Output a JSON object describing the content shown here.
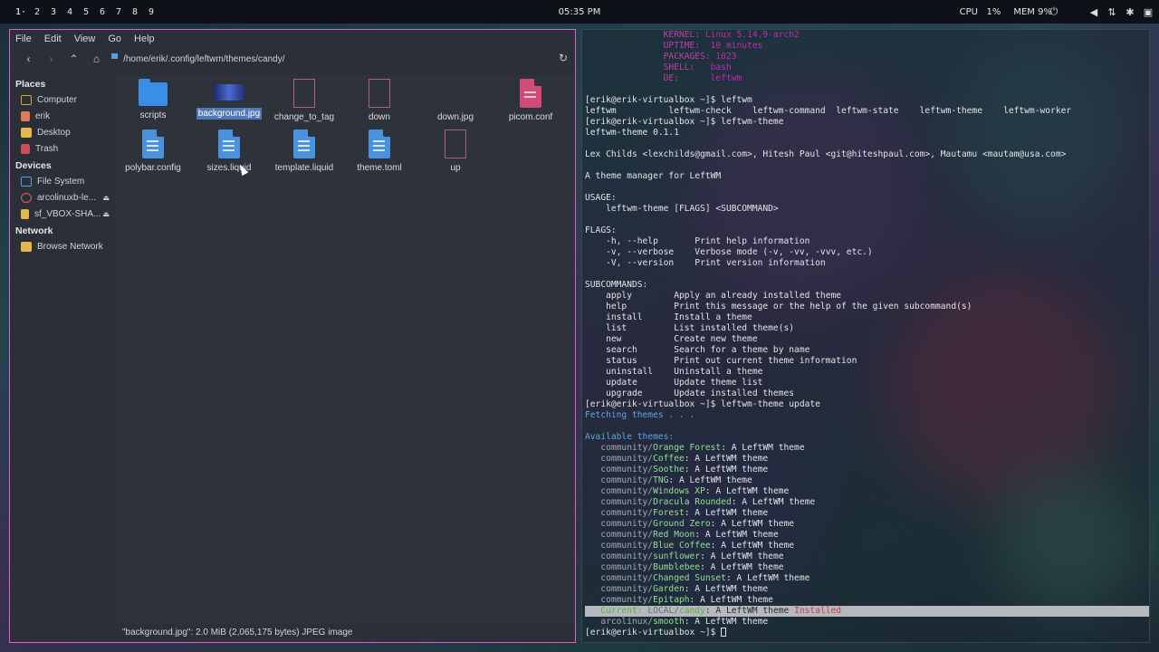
{
  "topbar": {
    "workspaces": [
      "1·",
      "2",
      "3",
      "4",
      "5",
      "6",
      "7",
      "8",
      "9"
    ],
    "clock": "05:35 PM",
    "cpu_label": "CPU",
    "cpu_value": "1%",
    "mem_label": "MEM",
    "mem_value": "9%",
    "tray_icons": [
      "power-icon",
      "volume-icon",
      "network-icon",
      "settings-icon",
      "display-icon"
    ]
  },
  "filemanager": {
    "menu": [
      "File",
      "Edit",
      "View",
      "Go",
      "Help"
    ],
    "path": "/home/erik/.config/leftwm/themes/candy/",
    "sidebar": {
      "places_header": "Places",
      "places": [
        "Computer",
        "erik",
        "Desktop",
        "Trash"
      ],
      "devices_header": "Devices",
      "devices": [
        "File System",
        "arcolinuxb-le...",
        "sf_VBOX-SHA..."
      ],
      "network_header": "Network",
      "network": [
        "Browse Network"
      ]
    },
    "files": [
      {
        "name": "scripts",
        "type": "folder"
      },
      {
        "name": "background.jpg",
        "type": "image",
        "selected": true
      },
      {
        "name": "change_to_tag",
        "type": "script"
      },
      {
        "name": "down",
        "type": "script"
      },
      {
        "name": "down.jpg",
        "type": "blank"
      },
      {
        "name": "picom.conf",
        "type": "conf"
      },
      {
        "name": "polybar.config",
        "type": "doc"
      },
      {
        "name": "sizes.liquid",
        "type": "doc"
      },
      {
        "name": "template.liquid",
        "type": "doc"
      },
      {
        "name": "theme.toml",
        "type": "doc"
      },
      {
        "name": "up",
        "type": "script"
      }
    ],
    "status": "\"background.jpg\": 2.0 MiB (2,065,175 bytes) JPEG image"
  },
  "terminal": {
    "neofetch": [
      {
        "key": "KERNEL:",
        "val": "Linux 5.14.9-arch2"
      },
      {
        "key": "UPTIME:",
        "val": "10 minutes"
      },
      {
        "key": "PACKAGES:",
        "val": "1023"
      },
      {
        "key": "SHELL:",
        "val": "bash"
      },
      {
        "key": "DE:",
        "val": "leftwm"
      }
    ],
    "lines": [
      "[erik@erik-virtualbox ~]$ leftwm",
      "leftwm          leftwm-check    leftwm-command  leftwm-state    leftwm-theme    leftwm-worker",
      "[erik@erik-virtualbox ~]$ leftwm-theme",
      "leftwm-theme 0.1.1",
      "",
      "Lex Childs <lexchilds@gmail.com>, Hitesh Paul <git@hiteshpaul.com>, Mautamu <mautam@usa.com>",
      "",
      "A theme manager for LeftWM",
      "",
      "USAGE:",
      "    leftwm-theme [FLAGS] <SUBCOMMAND>",
      "",
      "FLAGS:",
      "    -h, --help       Print help information",
      "    -v, --verbose    Verbose mode (-v, -vv, -vvv, etc.)",
      "    -V, --version    Print version information",
      "",
      "SUBCOMMANDS:",
      "    apply        Apply an already installed theme",
      "    help         Print this message or the help of the given subcommand(s)",
      "    install      Install a theme",
      "    list         List installed theme(s)",
      "    new          Create new theme",
      "    search       Search for a theme by name",
      "    status       Print out current theme information",
      "    uninstall    Uninstall a theme",
      "    update       Update theme list",
      "    upgrade      Update installed themes",
      "[erik@erik-virtualbox ~]$ leftwm-theme update"
    ],
    "fetching": "Fetching themes . . .",
    "available_header": "Available themes:",
    "themes": [
      "Orange Forest",
      "Coffee",
      "Soothe",
      "TNG",
      "Windows XP",
      "Dracula Rounded",
      "Forest",
      "Ground Zero",
      "Red Moon",
      "Blue Coffee",
      "sunflower",
      "Bumblebee",
      "Changed Sunset",
      "Garden",
      "Epitaph"
    ],
    "theme_suffix": ": A LeftWM theme",
    "community_prefix": "community/",
    "current_label": "Current:",
    "current_repo": "LOCAL/",
    "current_name": "candy",
    "installed_label": "Installed",
    "last_repo": "arcolinux/",
    "last_name": "smooth",
    "prompt": "[erik@erik-virtualbox ~]$ "
  }
}
